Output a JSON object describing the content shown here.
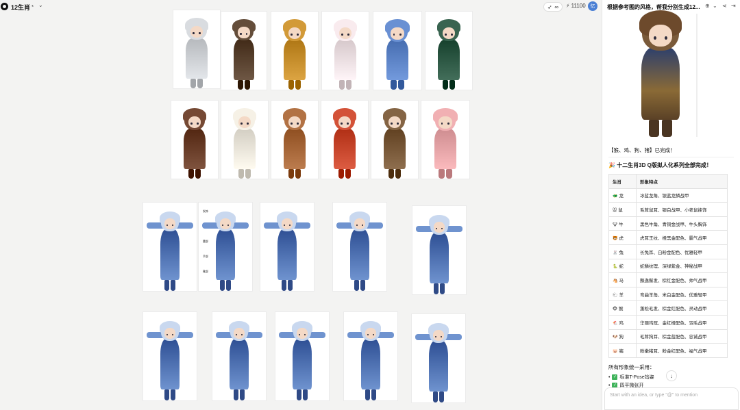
{
  "topbar": {
    "board_title": "12生肖",
    "credits": "11100",
    "infinite_label": "∞",
    "user_initial": "忆"
  },
  "panel": {
    "title": "根据参考图的风格，帮我分别生成12...",
    "done_text": "【猴、鸡、狗、猪】已完成！",
    "complete_text": "🎉 十二生肖3D Q版拟人化系列全部完成！",
    "table_headers": [
      "生肖",
      "形象特点"
    ],
    "rows": [
      {
        "icon": "🐲",
        "zodiac": "龙",
        "traits": "冰蓝龙角、银蓝龙鳞战甲"
      },
      {
        "icon": "🐭",
        "zodiac": "鼠",
        "traits": "毛茸鼠耳、银白战甲、小老鼠挂饰"
      },
      {
        "icon": "🐮",
        "zodiac": "牛",
        "traits": "黑色牛角、青铜金战甲、牛头胸饰"
      },
      {
        "icon": "🐯",
        "zodiac": "虎",
        "traits": "虎耳王纹、橙黑金配色、霸气战甲"
      },
      {
        "icon": "🐰",
        "zodiac": "兔",
        "traits": "长兔耳、白粉金配色、优雅轻甲"
      },
      {
        "icon": "🐍",
        "zodiac": "蛇",
        "traits": "蛇鳞纹理、深绿紫金、神秘战甲"
      },
      {
        "icon": "🐴",
        "zodiac": "马",
        "traits": "飘逸鬃发、棕红金配色、帅气战甲"
      },
      {
        "icon": "🐑",
        "zodiac": "羊",
        "traits": "弯曲羊角、米白金配色、优雅轻甲"
      },
      {
        "icon": "🐵",
        "zodiac": "猴",
        "traits": "蓬松毛发、棕金红配色、灵动战甲"
      },
      {
        "icon": "🐔",
        "zodiac": "鸡",
        "traits": "华丽鸡冠、金红橙配色、羽毛战甲"
      },
      {
        "icon": "🐶",
        "zodiac": "狗",
        "traits": "毛茸狗耳、棕金蓝配色、忠诚战甲"
      },
      {
        "icon": "🐷",
        "zodiac": "猪",
        "traits": "粉嫩猪耳、粉金红配色、福气战甲"
      }
    ],
    "shapes_text": "所有形象统一采用：",
    "bullets": [
      "标准T-Pose站姿",
      "四平微张开"
    ],
    "input_placeholder": "Start with an idea, or type \"@\" to mention"
  },
  "canvas": {
    "side_labels": [
      "发饰",
      "肩部",
      "腰部",
      "手部",
      "靴部"
    ]
  },
  "colors": {
    "rat": "#cfd2d6",
    "ox": "#5a4330",
    "tiger": "#c8902e",
    "rabbit": "#efe1e4",
    "dragon": "#5f86c9",
    "snake": "#2f5a46",
    "horse": "#6b3f2a",
    "goat": "#ece7dc",
    "monkey": "#a8683a",
    "rooster": "#c9482e",
    "dog": "#7a5a3a",
    "pig": "#e7a6a9"
  }
}
